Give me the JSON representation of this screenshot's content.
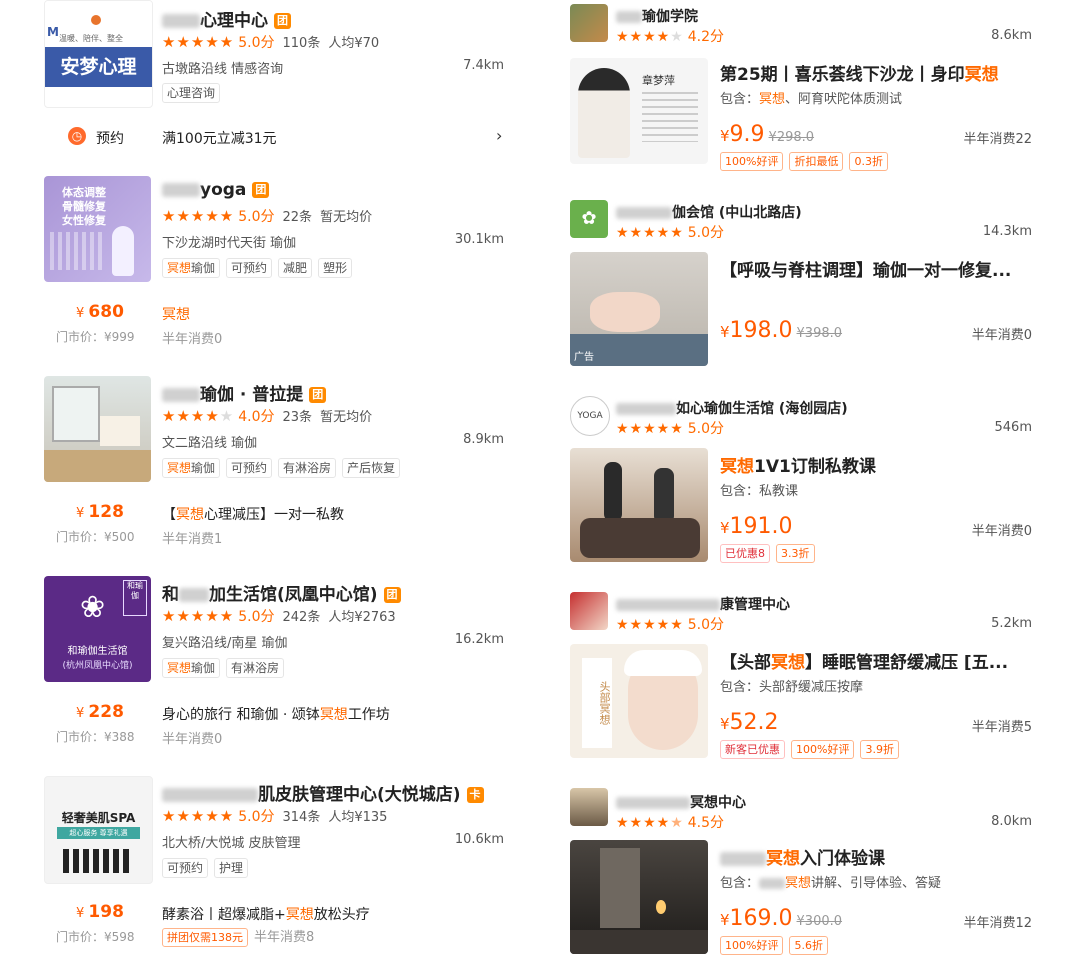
{
  "left": [
    {
      "title": "心理中心",
      "badge": "团",
      "stars_full": 5,
      "stars_empty": 0,
      "score": "5.0分",
      "reviews": "110条",
      "avg": "人均¥70",
      "location": "古墩路沿线  情感咨询",
      "distance": "7.4km",
      "tags": [
        "心理咨询"
      ],
      "thumb_text": "安梦心理",
      "thumb_sub": "温暖、陪伴、整全",
      "reserve_label": "预约",
      "reserve_text": "满100元立减31元"
    },
    {
      "title": "yoga",
      "badge": "团",
      "stars_full": 5,
      "stars_empty": 0,
      "score": "5.0分",
      "reviews": "22条",
      "avg": "暂无均价",
      "location": "下沙龙湖时代天街  瑜伽",
      "distance": "30.1km",
      "tags": [
        "冥想瑜伽",
        "可预约",
        "减肥",
        "塑形"
      ],
      "thumb_lines": [
        "体态调整",
        "骨髓修复",
        "女性修复"
      ],
      "price": "680",
      "orig": "门市价：¥999",
      "deal": "冥想",
      "sales": "半年消费0"
    },
    {
      "title": "瑜伽 · 普拉提",
      "badge": "团",
      "stars_full": 4,
      "stars_empty": 1,
      "score": "4.0分",
      "reviews": "23条",
      "avg": "暂无均价",
      "location": "文二路沿线  瑜伽",
      "distance": "8.9km",
      "tags": [
        "冥想瑜伽",
        "可预约",
        "有淋浴房",
        "产后恢复"
      ],
      "price": "128",
      "orig": "门市价：¥500",
      "deal_pre": "【",
      "deal_hl": "冥想",
      "deal_post": "心理减压】一对一私教",
      "sales": "半年消费1"
    },
    {
      "title_pre": "和",
      "title": "加生活馆(凤凰中心馆)",
      "badge": "团",
      "stars_full": 5,
      "stars_empty": 0,
      "score": "5.0分",
      "reviews": "242条",
      "avg": "人均¥2763",
      "location": "复兴路沿线/南星  瑜伽",
      "distance": "16.2km",
      "tags": [
        "冥想瑜伽",
        "有淋浴房"
      ],
      "thumb_text": "和瑜伽生活馆",
      "thumb_sub": "(杭州凤凰中心馆)",
      "thumb_tag": "和瑜伽",
      "price": "228",
      "orig": "门市价：¥388",
      "deal_pre": "身心的旅行 和瑜伽 · 颂钵",
      "deal_hl": "冥想",
      "deal_post": "工作坊",
      "sales": "半年消费0"
    },
    {
      "title": "肌皮肤管理中心(大悦城店)",
      "badge": "卡",
      "stars_full": 5,
      "stars_empty": 0,
      "score": "5.0分",
      "reviews": "314条",
      "avg": "人均¥135",
      "location": "北大桥/大悦城  皮肤管理",
      "distance": "10.6km",
      "tags": [
        "可预约",
        "护理"
      ],
      "thumb_text": "轻奢美肌SPA",
      "thumb_sub": "超心服务 尊享礼遇",
      "price": "198",
      "orig": "门市价：¥598",
      "deal_pre": "酵素浴丨超爆减脂+",
      "deal_hl": "冥想",
      "deal_post": "放松头疗",
      "promo": "拼团仅需138元",
      "sales": "半年消费8"
    }
  ],
  "right": [
    {
      "shop": "瑜伽学院",
      "stars_full": 4,
      "stars_empty": 1,
      "score": "4.2分",
      "distance": "8.6km",
      "deal_title_pre": "第25期丨喜乐荟线下沙龙丨身印",
      "deal_title_hl": "冥想",
      "includes_pre": "包含：",
      "includes_hl": "冥想",
      "includes_post": "、阿育吠陀体质测试",
      "price": "9.9",
      "orig": "¥298.0",
      "sales": "半年消费22",
      "ptags": [
        "100%好评",
        "折扣最低",
        "0.3折"
      ],
      "thumb_name": "章梦萍"
    },
    {
      "shop": "伽会馆 (中山北路店)",
      "stars_full": 5,
      "stars_empty": 0,
      "score": "5.0分",
      "distance": "14.3km",
      "deal_title": "【呼吸与脊柱调理】瑜伽一对一修复...",
      "price": "198.0",
      "orig": "¥398.0",
      "sales": "半年消费0",
      "ad": "广告"
    },
    {
      "shop": "如心瑜伽生活馆 (海创园店)",
      "stars_full": 5,
      "stars_empty": 0,
      "score": "5.0分",
      "distance": "546m",
      "deal_title_hl": "冥想",
      "deal_title_post": "1V1订制私教课",
      "includes": "包含：私教课",
      "price": "191.0",
      "sales": "半年消费0",
      "ptags_red": [
        "已优惠8"
      ],
      "ptags": [
        "3.3折"
      ]
    },
    {
      "shop": "康管理中心",
      "stars_full": 5,
      "stars_empty": 0,
      "score": "5.0分",
      "distance": "5.2km",
      "deal_title_pre": "【头部",
      "deal_title_hl": "冥想",
      "deal_title_post": "】睡眠管理舒缓减压 [五...",
      "includes": "包含：头部舒缓减压按摩",
      "price": "52.2",
      "sales": "半年消费5",
      "ptags_red": [
        "新客已优惠"
      ],
      "ptags": [
        "100%好评",
        "3.9折"
      ],
      "thumb_text": "头部冥想"
    },
    {
      "shop": "冥想中心",
      "stars_full": 4,
      "stars_empty": 1,
      "score": "4.5分",
      "distance": "8.0km",
      "deal_title_hl": "冥想",
      "deal_title_post": "入门体验课",
      "includes_pre": "包含：",
      "includes_hl": "冥想",
      "includes_post": "讲解、引导体验、答疑",
      "price": "169.0",
      "orig": "¥300.0",
      "sales": "半年消费12",
      "ptags": [
        "100%好评",
        "5.6折"
      ]
    }
  ]
}
